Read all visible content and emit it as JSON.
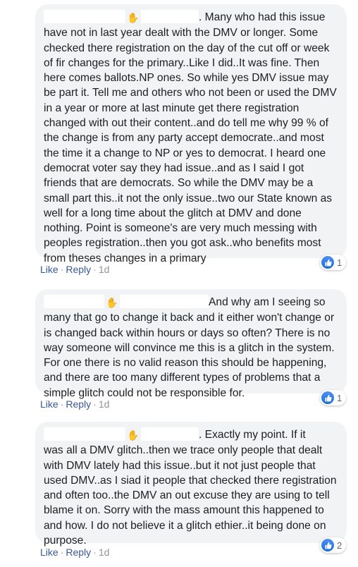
{
  "comments": [
    {
      "mention_suffix": ". Many who had this issue",
      "body": "have not in last year dealt with the DMV or longer. Some checked there registration on the day of the cut off or week of fir changes for the primary..Like I did..It was fine. Then here comes ballots.NP ones. So while yes DMV issue may be part it. Tell me and others who not been or used the DMV in a year or more at last minute get there registration changed with out their content..and do tell me why 99 % of the change is from any party accept democrate..and most the time it a change to NP or yes to democrat. I heard one democrat voter say they had issue..and as I said I got friends that are democrats. So while the DMV may be a small part this..it not the only issue..two our State known as well for a long time about the glitch at DMV and done nothing. Point is someone's are very much messing with peoples registration..then you got ask..who benefits most from theses changes in a primary",
      "like_label": "Like",
      "reply_label": "Reply",
      "time": "1d",
      "reaction_count": "1"
    },
    {
      "mention_suffix": "And why am I seeing so",
      "body": "many that go to change it back and it either won't change or is changed back within hours or days so often? There is no way someone will convince me this is a glitch in the system. For one there is no valid reason this should be happening, and there are too many different types of problems that a simple glitch could not be responsible for.",
      "like_label": "Like",
      "reply_label": "Reply",
      "time": "1d",
      "reaction_count": "1"
    },
    {
      "mention_suffix": ". Exactly my point. If it",
      "body": "was all a DMV glitch..then we trace only people that dealt with DMV lately had this issue..but it not just people that used DMV..as I siad it people that checked there registration and often too..the DMV an out excuse they are using to tell blame it on. Sorry with the mass amount this happened to and how. I do not believe it a glitch ethier..it being done on purpose.",
      "like_label": "Like",
      "reply_label": "Reply",
      "time": "1d",
      "reaction_count": "2"
    }
  ],
  "icons": {
    "wave": "waving-hand-icon",
    "reaction": "thumbs-up-like-icon"
  },
  "colors": {
    "bubble": "#f2f3f5",
    "link": "#385898",
    "meta": "#90949c",
    "like_blue": "#1a6ed8"
  }
}
